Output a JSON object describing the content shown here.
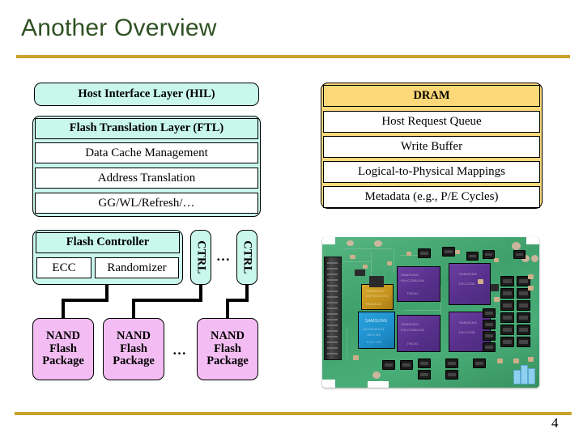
{
  "slide": {
    "title": "Another Overview",
    "page_number": "4",
    "accent_rule_color": "#c8a22a",
    "title_color": "#2f5122"
  },
  "colors": {
    "cyan_fill": "#c9f7ec",
    "gold_fill": "#fcd878",
    "pink_fill": "#f3bdf3",
    "white_fill": "#ffffff",
    "outline": "#000000"
  },
  "diagram": {
    "host_interface": {
      "label": "Host Interface Layer (HIL)"
    },
    "ftl": {
      "header": "Flash Translation Layer (FTL)",
      "items": [
        {
          "label": "Data Cache Management"
        },
        {
          "label": "Address Translation"
        },
        {
          "label": "GG/WL/Refresh/…"
        }
      ]
    },
    "dram": {
      "header": "DRAM",
      "items": [
        {
          "label": "Host Request Queue"
        },
        {
          "label": "Write Buffer"
        },
        {
          "label": "Logical-to-Physical Mappings"
        },
        {
          "label": "Metadata (e.g., P/E Cycles)"
        }
      ]
    },
    "flash_controller": {
      "header": "Flash Controller",
      "blocks": [
        {
          "label": "ECC"
        },
        {
          "label": "Randomizer"
        }
      ]
    },
    "controllers": [
      {
        "label": "CTRL"
      },
      {
        "label": "CTRL"
      }
    ],
    "controller_ellipsis": "…",
    "nand_packages": [
      {
        "line1": "NAND",
        "line2": "Flash",
        "line3": "Package"
      },
      {
        "line1": "NAND",
        "line2": "Flash",
        "line3": "Package"
      },
      {
        "line1": "NAND",
        "line2": "Flash",
        "line3": "Package"
      }
    ],
    "nand_ellipsis": "…"
  },
  "photo": {
    "caption": "",
    "alt_name": "ssd-circuit-board-photo",
    "chip_labels": {
      "controller": "SAMSUNG",
      "nand_1": "SAMSUNG",
      "nand_2": "SAMSUNG",
      "nand_3": "SAMSUNG",
      "nand_4": "SAMSUNG",
      "dram": "SAMSUNG"
    }
  }
}
